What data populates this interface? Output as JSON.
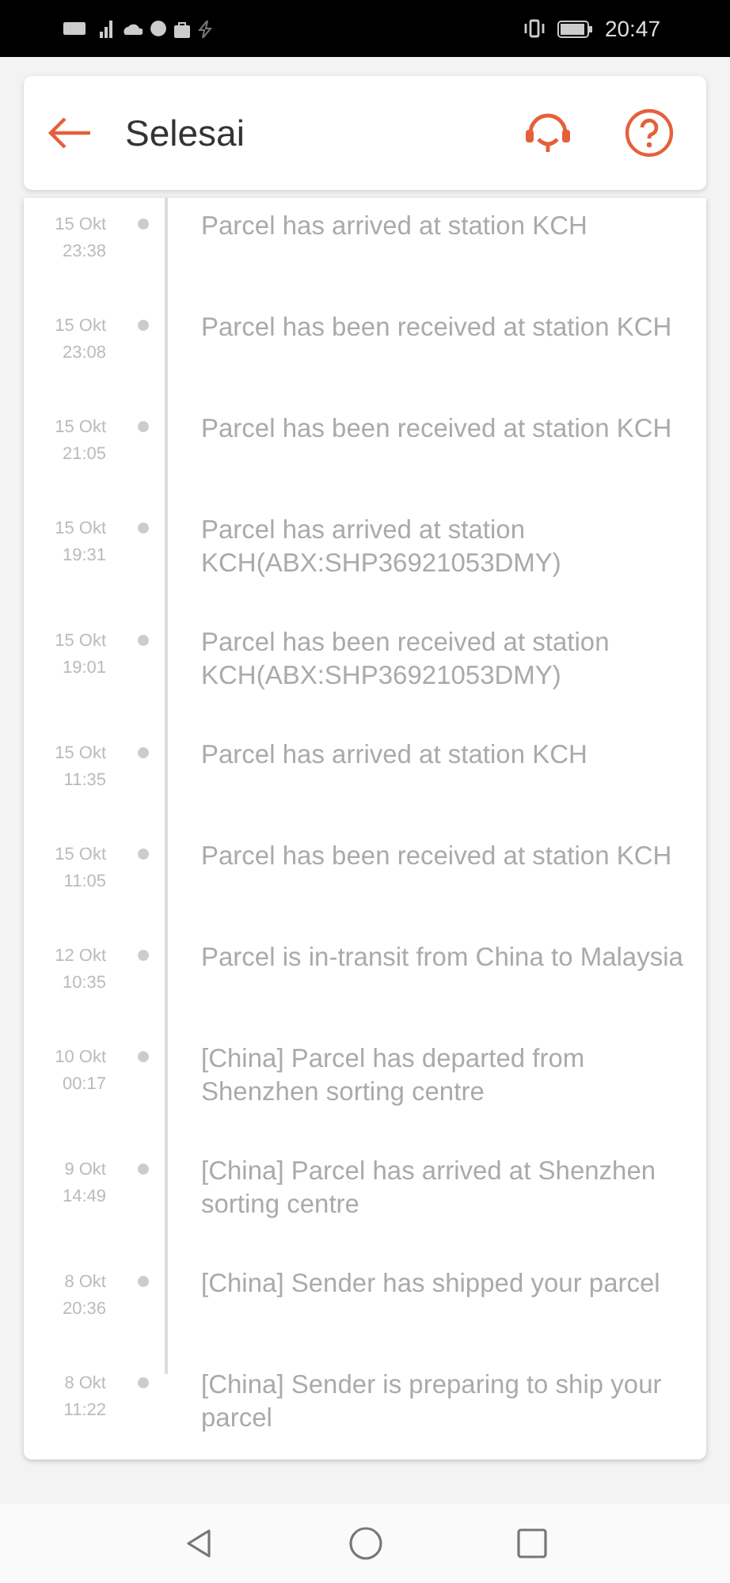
{
  "status_bar": {
    "time": "20:47"
  },
  "header": {
    "title": "Selesai"
  },
  "events": [
    {
      "date": "15 Okt",
      "time": "23:38",
      "text": "Parcel has arrived at station KCH"
    },
    {
      "date": "15 Okt",
      "time": "23:08",
      "text": "Parcel has been received at station KCH"
    },
    {
      "date": "15 Okt",
      "time": "21:05",
      "text": "Parcel has been received at station KCH"
    },
    {
      "date": "15 Okt",
      "time": "19:31",
      "text": "Parcel has arrived at station KCH(ABX:SHP36921053DMY)"
    },
    {
      "date": "15 Okt",
      "time": "19:01",
      "text": "Parcel has been received at station KCH(ABX:SHP36921053DMY)"
    },
    {
      "date": "15 Okt",
      "time": "11:35",
      "text": "Parcel has arrived at station KCH"
    },
    {
      "date": "15 Okt",
      "time": "11:05",
      "text": "Parcel has been received at station KCH"
    },
    {
      "date": "12 Okt",
      "time": "10:35",
      "text": "Parcel is in-transit from China to Malaysia"
    },
    {
      "date": "10 Okt",
      "time": "00:17",
      "text": "[China] Parcel has departed from Shenzhen sorting centre"
    },
    {
      "date": "9 Okt",
      "time": "14:49",
      "text": "[China] Parcel has arrived at Shenzhen sorting centre"
    },
    {
      "date": "8 Okt",
      "time": "20:36",
      "text": "[China] Sender has shipped your parcel"
    },
    {
      "date": "8 Okt",
      "time": "11:22",
      "text": "[China] Sender is preparing to ship your parcel"
    }
  ]
}
